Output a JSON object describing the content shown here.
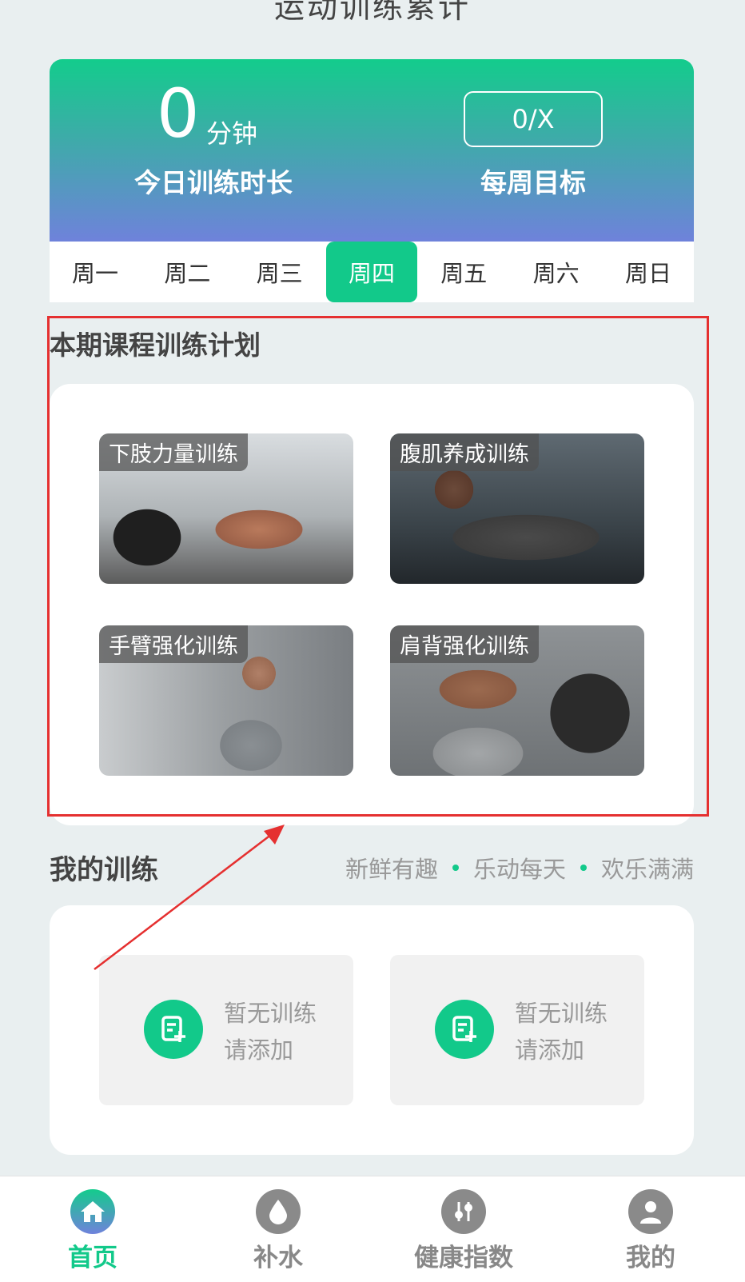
{
  "app": {
    "title": "运动训练累计"
  },
  "stats": {
    "duration_value": "0",
    "duration_unit": "分钟",
    "duration_label": "今日训练时长",
    "goal_value": "0/X",
    "goal_label": "每周目标"
  },
  "weekdays": {
    "days": [
      "周一",
      "周二",
      "周三",
      "周四",
      "周五",
      "周六",
      "周日"
    ],
    "selected": "周四"
  },
  "plan": {
    "title": "本期课程训练计划",
    "courses": [
      {
        "label": "下肢力量训练"
      },
      {
        "label": "腹肌养成训练"
      },
      {
        "label": "手臂强化训练"
      },
      {
        "label": "肩背强化训练"
      }
    ]
  },
  "my_training": {
    "title": "我的训练",
    "slogan": [
      "新鲜有趣",
      "乐动每天",
      "欢乐满满"
    ],
    "slots": [
      {
        "line1": "暂无训练",
        "line2": "请添加"
      },
      {
        "line1": "暂无训练",
        "line2": "请添加"
      }
    ]
  },
  "tabbar": {
    "items": [
      {
        "label": "首页",
        "icon": "home-icon"
      },
      {
        "label": "补水",
        "icon": "water-drop-icon"
      },
      {
        "label": "健康指数",
        "icon": "sliders-icon"
      },
      {
        "label": "我的",
        "icon": "user-icon"
      }
    ],
    "active": "首页"
  },
  "colors": {
    "accent": "#12c98a",
    "gradient_top": "#13cc8c",
    "gradient_bottom": "#6f82db",
    "annotation": "#e53030"
  }
}
